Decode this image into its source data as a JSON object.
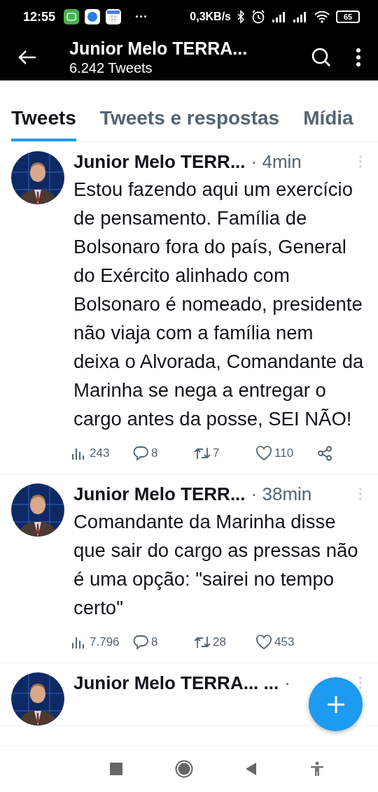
{
  "status_bar": {
    "time": "12:55",
    "more": "···",
    "speed": "0,3KB/s",
    "battery": "65"
  },
  "header": {
    "title": "Junior Melo TERRA...",
    "subtitle": "6.242 Tweets"
  },
  "tabs": [
    {
      "label": "Tweets",
      "selected": true
    },
    {
      "label": "Tweets e respostas",
      "selected": false
    },
    {
      "label": "Mídia",
      "selected": false
    }
  ],
  "tweets": [
    {
      "name": "Junior Melo TERR...",
      "time": "· 4min",
      "text": "Estou fazendo aqui um exercício de pensamento. Família de Bolsonaro fora do país, General do Exército alinhado com Bolsonaro é nomeado, presidente não viaja com a família nem deixa o Alvorada, Comandante da Marinha se nega a entregar o cargo antes da posse, SEI NÃO!",
      "views": "243",
      "replies": "8",
      "retweets": "7",
      "likes": "110",
      "share": true
    },
    {
      "name": "Junior Melo TERR...",
      "time": "· 38min",
      "text": "Comandante da Marinha disse que sair do cargo as pressas não é uma opção: \"sairei no tempo certo\"",
      "views": "7.796",
      "replies": "8",
      "retweets": "28",
      "likes": "453",
      "share": false
    },
    {
      "name": "Junior Melo TERRA... ...",
      "time": "·"
    }
  ]
}
